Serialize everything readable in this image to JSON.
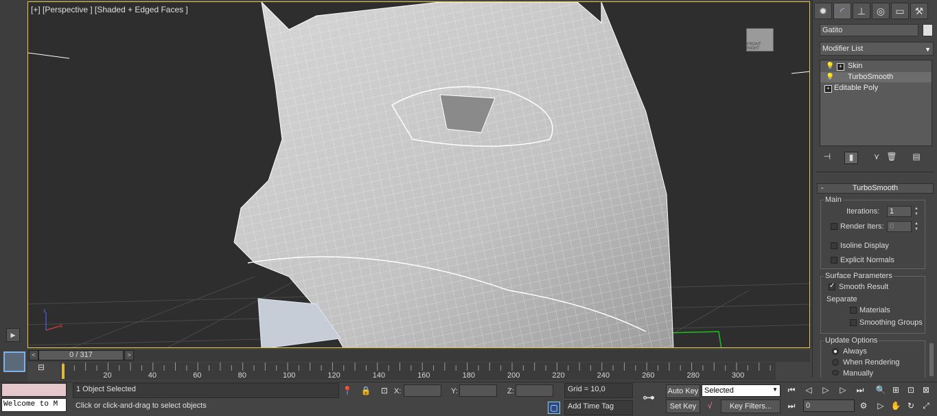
{
  "viewport": {
    "label": "[+] [Perspective ] [Shaded + Edged Faces ]",
    "viewcube_text": "FRONT · RIGHT"
  },
  "command_panel": {
    "tabs": [
      "create-icon",
      "modify-icon",
      "hierarchy-icon",
      "motion-icon",
      "display-icon",
      "utilities-icon"
    ],
    "object_name": "Gatito",
    "object_color": "#e0e0e0",
    "modifier_list": "Modifier List",
    "stack": [
      {
        "label": "Skin",
        "expand": "+",
        "bulb": true
      },
      {
        "label": "TurboSmooth",
        "expand": "",
        "bulb": true
      },
      {
        "label": "Editable Poly",
        "expand": "+",
        "bulb": false
      }
    ],
    "rollout_title": "TurboSmooth",
    "main_group": "Main",
    "iterations_label": "Iterations:",
    "iterations_value": "1",
    "render_iters_label": "Render Iters:",
    "render_iters_value": "0",
    "isoline_label": "Isoline Display",
    "explicit_normals_label": "Explicit Normals",
    "surface_group": "Surface Parameters",
    "smooth_result_label": "Smooth Result",
    "separate_label": "Separate",
    "materials_label": "Materials",
    "smoothing_groups_label": "Smoothing Groups",
    "update_group": "Update Options",
    "always_label": "Always",
    "when_rendering_label": "When Rendering",
    "manually_label": "Manually"
  },
  "timeline": {
    "slider": "0 / 317",
    "prev": "<",
    "next": ">",
    "ticks": [
      "20",
      "40",
      "60",
      "80",
      "100",
      "120",
      "140",
      "160",
      "180",
      "200",
      "220",
      "240",
      "260",
      "280",
      "300"
    ]
  },
  "status": {
    "maxscript": "Welcome to M",
    "selection": "1 Object Selected",
    "prompt": "Click or click-and-drag to select objects",
    "x_label": "X:",
    "y_label": "Y:",
    "z_label": "Z:",
    "grid": "Grid = 10,0",
    "add_time_tag": "Add Time Tag",
    "auto_key": "Auto Key",
    "set_key": "Set Key",
    "selected": "Selected",
    "key_filters": "Key Filters...",
    "frame": "0"
  }
}
